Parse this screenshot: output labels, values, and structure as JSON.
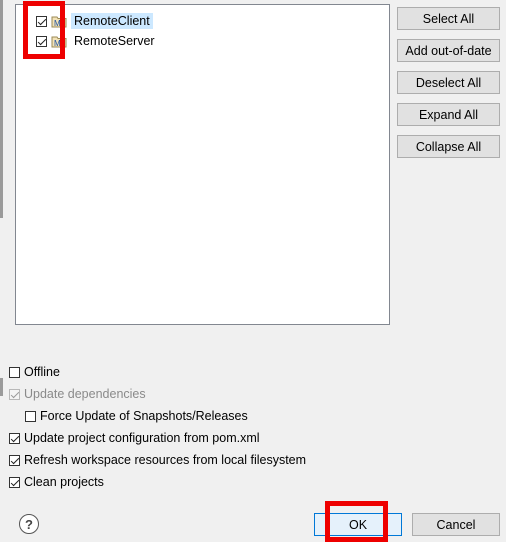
{
  "projects": [
    {
      "name": "RemoteClient",
      "checked": true,
      "selected": true
    },
    {
      "name": "RemoteServer",
      "checked": true,
      "selected": false
    }
  ],
  "side_buttons": {
    "select_all": "Select All",
    "add_out_of_date": "Add out-of-date",
    "deselect_all": "Deselect All",
    "expand_all": "Expand All",
    "collapse_all": "Collapse All"
  },
  "options": {
    "offline": {
      "label": "Offline",
      "checked": false
    },
    "update_dependencies": {
      "label": "Update dependencies",
      "checked": true,
      "disabled": true
    },
    "force_update": {
      "label": "Force Update of Snapshots/Releases",
      "checked": false
    },
    "update_project_config": {
      "label": "Update project configuration from pom.xml",
      "checked": true
    },
    "refresh_workspace": {
      "label": "Refresh workspace resources from local filesystem",
      "checked": true
    },
    "clean_projects": {
      "label": "Clean projects",
      "checked": true
    }
  },
  "footer": {
    "help_glyph": "?",
    "ok_label": "OK",
    "cancel_label": "Cancel"
  },
  "icons": {
    "project": "maven-project-icon",
    "help": "help-icon"
  },
  "colors": {
    "annotation_red": "#ee0000",
    "selection": "#cce8ff",
    "default_button_border": "#0078d7"
  }
}
